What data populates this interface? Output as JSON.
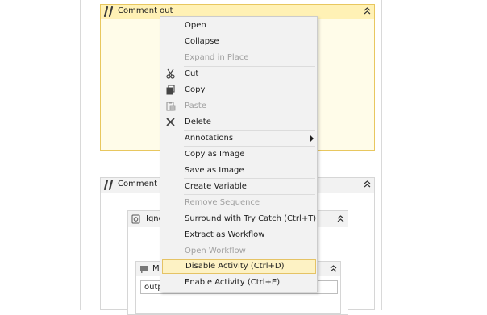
{
  "designer": {
    "activity1": {
      "title": "Comment out"
    },
    "activity2": {
      "title": "Comment out",
      "inner": {
        "title": "Ignore",
        "child": {
          "title": "Message",
          "field_value": "output"
        }
      }
    }
  },
  "context_menu": {
    "items": [
      {
        "label": "Open",
        "enabled": true,
        "icon": ""
      },
      {
        "label": "Collapse",
        "enabled": true,
        "icon": ""
      },
      {
        "label": "Expand in Place",
        "enabled": false,
        "icon": ""
      },
      {
        "label": "Cut",
        "enabled": true,
        "icon": "scissors-icon"
      },
      {
        "label": "Copy",
        "enabled": true,
        "icon": "copy-icon"
      },
      {
        "label": "Paste",
        "enabled": false,
        "icon": "paste-icon"
      },
      {
        "label": "Delete",
        "enabled": true,
        "icon": "delete-x-icon"
      },
      {
        "label": "Annotations",
        "enabled": true,
        "icon": "",
        "submenu": true
      },
      {
        "label": "Copy as Image",
        "enabled": true,
        "icon": ""
      },
      {
        "label": "Save as Image",
        "enabled": true,
        "icon": ""
      },
      {
        "label": "Create Variable",
        "enabled": true,
        "icon": ""
      },
      {
        "label": "Remove Sequence",
        "enabled": false,
        "icon": ""
      },
      {
        "label": "Surround with Try Catch (Ctrl+T)",
        "enabled": true,
        "icon": ""
      },
      {
        "label": "Extract as Workflow",
        "enabled": true,
        "icon": ""
      },
      {
        "label": "Open Workflow",
        "enabled": false,
        "icon": ""
      },
      {
        "label": "Disable Activity (Ctrl+D)",
        "enabled": true,
        "highlighted": true,
        "icon": ""
      },
      {
        "label": "Enable Activity (Ctrl+E)",
        "enabled": true,
        "icon": ""
      }
    ]
  },
  "colors": {
    "comment_header": "#fff1b5",
    "comment_border": "#e8c75f",
    "menu_highlight": "#fdf2c4",
    "disabled_text": "#a0a0a0"
  }
}
